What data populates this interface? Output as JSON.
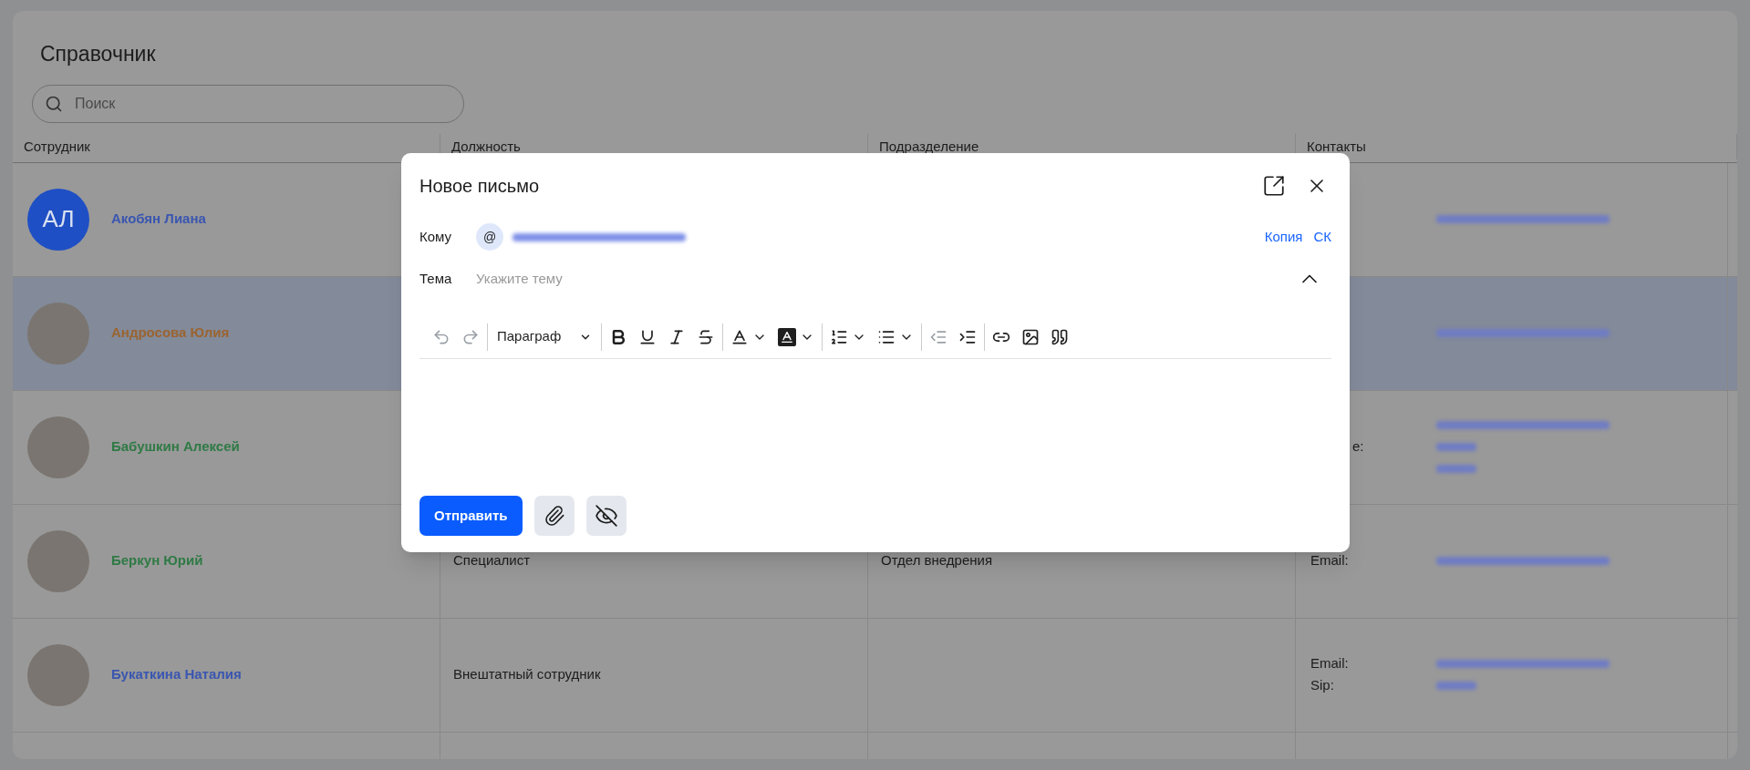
{
  "page": {
    "title": "Справочник",
    "search": {
      "placeholder": "Поиск"
    }
  },
  "table": {
    "columns": [
      "Сотрудник",
      "Должность",
      "Подразделение",
      "Контакты"
    ],
    "rows": [
      {
        "avatar": {
          "kind": "initials",
          "initials": "АЛ"
        },
        "name": "Акобян Лиана",
        "color": "#3a56b0",
        "selected": false,
        "contacts": [
          {
            "kind": "email"
          }
        ]
      },
      {
        "avatar": {
          "kind": "photo"
        },
        "name": "Андросова Юлия",
        "color": "#9a6431",
        "selected": true,
        "contacts": [
          {
            "kind": "email"
          }
        ]
      },
      {
        "avatar": {
          "kind": "photo"
        },
        "name": "Бабушкин Алексей",
        "color": "#2f7a45",
        "selected": false,
        "contacts": [
          {
            "kind": "email"
          },
          {
            "kind": "phone",
            "label": "e:",
            "label_cut": true
          },
          {
            "kind": "phone"
          }
        ]
      },
      {
        "avatar": {
          "kind": "photo"
        },
        "name": "Беркун Юрий",
        "color": "#2f7a45",
        "selected": false,
        "position": "Специалист",
        "department": "Отдел внедрения",
        "contacts": [
          {
            "kind": "email",
            "label": "Email:"
          }
        ]
      },
      {
        "avatar": {
          "kind": "photo"
        },
        "name": "Букаткина Наталия",
        "color": "#3a56b0",
        "selected": false,
        "position": "Внештатный сотрудник",
        "contacts": [
          {
            "kind": "email",
            "label": "Email:"
          },
          {
            "kind": "phone",
            "label": "Sip:"
          }
        ]
      }
    ]
  },
  "compose": {
    "title": "Новое письмо",
    "to": {
      "label": "Кому",
      "at": "@"
    },
    "links": [
      "Копия",
      "СК"
    ],
    "subject": {
      "label": "Тема",
      "placeholder": "Укажите тему"
    },
    "toolbar": [
      [
        {
          "kind": "undo",
          "disabled": true
        },
        {
          "kind": "redo",
          "disabled": true
        }
      ],
      [
        {
          "kind": "block",
          "value": "Параграф",
          "disabled": false
        }
      ],
      [
        {
          "kind": "bold",
          "disabled": false
        },
        {
          "kind": "underline",
          "disabled": false
        },
        {
          "kind": "italic",
          "disabled": false
        },
        {
          "kind": "strike",
          "disabled": false
        }
      ],
      [
        {
          "kind": "text-color",
          "disabled": false
        },
        {
          "kind": "highlight",
          "disabled": false
        }
      ],
      [
        {
          "kind": "ordered-list",
          "disabled": false
        },
        {
          "kind": "bullet-list",
          "disabled": false
        }
      ],
      [
        {
          "kind": "outdent",
          "disabled": true
        },
        {
          "kind": "indent",
          "disabled": false
        }
      ],
      [
        {
          "kind": "link",
          "disabled": false
        },
        {
          "kind": "image",
          "disabled": false
        },
        {
          "kind": "quote",
          "disabled": false
        }
      ]
    ],
    "send": "Отправить"
  }
}
